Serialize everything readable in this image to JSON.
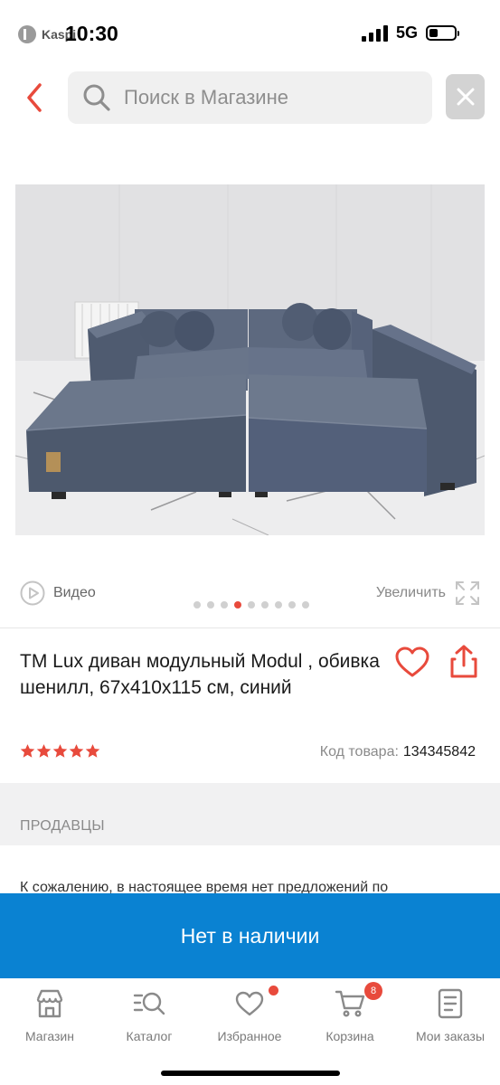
{
  "status_bar": {
    "carrier": "Kaspi",
    "time": "10:30",
    "network": "5G"
  },
  "search": {
    "placeholder": "Поиск в Магазине"
  },
  "media": {
    "video_label": "Видео",
    "zoom_label": "Увеличить",
    "image_count": 9,
    "active_image": 4,
    "accent_color": "#e84a3c"
  },
  "product": {
    "title": "TM Lux диван модульный Modul , обивка шенилл, 67x410x115 см, синий",
    "rating": 5,
    "code_label": "Код товара:",
    "code_value": "134345842"
  },
  "sellers": {
    "title": "ПРОДАВЦЫ",
    "empty_text": "К сожалению, в настоящее время нет предложений по"
  },
  "cta": {
    "label": "Нет в наличии",
    "color": "#0a82d2"
  },
  "nav": {
    "items": [
      {
        "label": "Магазин",
        "icon": "store-icon"
      },
      {
        "label": "Каталог",
        "icon": "catalog-search-icon"
      },
      {
        "label": "Избранное",
        "icon": "heart-icon"
      },
      {
        "label": "Корзина",
        "icon": "cart-icon",
        "badge": "8"
      },
      {
        "label": "Мои заказы",
        "icon": "orders-icon"
      }
    ]
  }
}
